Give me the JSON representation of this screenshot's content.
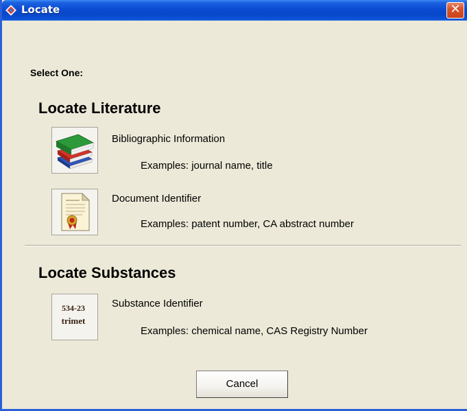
{
  "window": {
    "title": "Locate",
    "close_glyph": "✕"
  },
  "prompt": "Select One:",
  "sections": [
    {
      "heading": "Locate Literature",
      "options": [
        {
          "icon": "books-icon",
          "label": "Bibliographic Information",
          "example": "Examples: journal name, title"
        },
        {
          "icon": "certificate-document-icon",
          "label": "Document Identifier",
          "example": "Examples: patent number, CA abstract number"
        }
      ]
    },
    {
      "heading": "Locate Substances",
      "options": [
        {
          "icon": "substance-id-icon",
          "icon_text_line1": "534-23",
          "icon_text_line2": "trimet",
          "label": "Substance Identifier",
          "example": "Examples: chemical name, CAS Registry Number"
        }
      ]
    }
  ],
  "buttons": {
    "cancel_label": "Cancel"
  },
  "colors": {
    "titlebar": "#0a4bd3",
    "dialog_bg": "#ece9d8",
    "close_button": "#d8542c"
  }
}
